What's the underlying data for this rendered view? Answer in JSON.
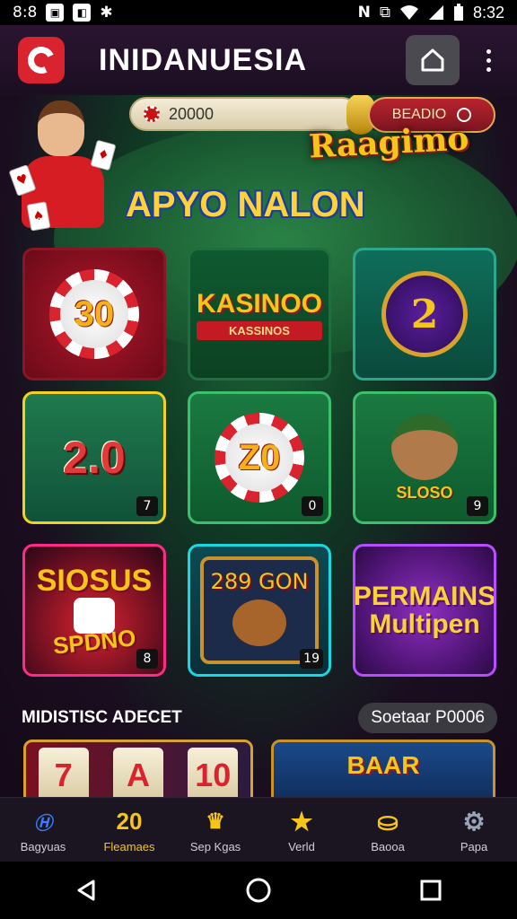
{
  "status_bar": {
    "left_text": "8:8",
    "time": "8:32",
    "icons": [
      "photo-icon",
      "image-icon",
      "notification-icon",
      "nfc-icon",
      "vibrate-icon",
      "wifi-icon",
      "signal-icon",
      "battery-icon"
    ]
  },
  "header": {
    "title": "INIDANUESIA",
    "logo_icon": "app-logo-icon",
    "home_icon": "home-icon",
    "menu_icon": "more-vert-icon"
  },
  "banner": {
    "balance": "20000",
    "action_label": "BEADIO",
    "brand_text": "Raagimo",
    "headline": "APYO NALON"
  },
  "games": [
    {
      "art": "30",
      "badge": ""
    },
    {
      "art": "KASINOO",
      "sub": "KASSINOS",
      "badge": ""
    },
    {
      "art": "2",
      "badge": ""
    },
    {
      "art": "2.0",
      "badge": "7"
    },
    {
      "art": "Z0",
      "badge": "0"
    },
    {
      "art": "SLOSO",
      "badge": "9"
    },
    {
      "art": "SIOSUS",
      "sub": "SPDNO",
      "badge": "8"
    },
    {
      "art": "289 GON",
      "badge": "19"
    },
    {
      "art": "PERMAINS",
      "sub": "Multipen",
      "badge": ""
    }
  ],
  "section": {
    "title": "MIDISTISC ADECET",
    "link": "Soetaar P0006"
  },
  "promo_cards": [
    {
      "symbols": [
        "7",
        "A",
        "10"
      ]
    },
    {
      "title": "BAAR"
    }
  ],
  "bottom_nav": [
    {
      "label": "Bagyuas",
      "icon": "slots-icon",
      "active": false
    },
    {
      "label": "Fleamaes",
      "icon": "chip-20-icon",
      "active": true
    },
    {
      "label": "Sep Kgas",
      "icon": "crown-icon",
      "active": false
    },
    {
      "label": "Verld",
      "icon": "star-icon",
      "active": false
    },
    {
      "label": "Baooa",
      "icon": "coins-icon",
      "active": false
    },
    {
      "label": "Papa",
      "icon": "settings-icon",
      "active": false
    }
  ],
  "colors": {
    "accent_gold": "#f5c518",
    "brand_red": "#d9232e"
  }
}
